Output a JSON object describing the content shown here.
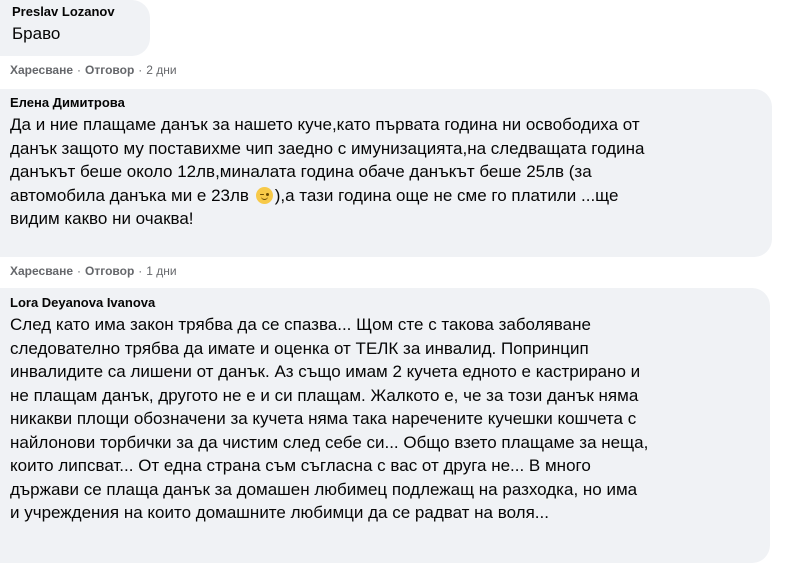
{
  "comments": [
    {
      "author": "Preslav Lozanov",
      "text": "Браво",
      "like_label": "Харесване",
      "reply_label": "Отговор",
      "time": "2 дни"
    },
    {
      "author": "Елена Димитрова",
      "text_before_emoji": "Да и ние плащаме данък за нашето куче,като първата година ни освободиха от\nданък защото му поставихме чип заедно с имунизацията,на следващата година\nданъкът беше около 12лв,миналата година обаче данъкът беше 25лв (за\nавтомобила данъка ми е 23лв ",
      "text_after_emoji": "),а тази година още не сме го платили ...ще\nвидим какво ни очаква!",
      "emoji": "wink-face-emoji",
      "like_label": "Харесване",
      "reply_label": "Отговор",
      "time": "1 дни"
    },
    {
      "author": "Lora Deyanova Ivanova",
      "text": "След като има закон трябва да се спазва... Щом сте с такова заболяване\nследователно трябва да имате и оценка от ТЕЛК за инвалид. Попринцип\nинвалидите са лишени от данък. Аз също имам 2 кучета едното е кастрирано и\nне плащам данък, другото не е и си плащам. Жалкото е, че за този данък няма\nникакви площи обозначени за кучета няма така наречените кучешки кошчета с\nнайлонови торбички за да чистим след себе си... Общо взето плащаме за неща,\nкоито липсват... От една страна съм съгласна с вас от друга не... В много\nдържави се плаща данък за домашен любимец подлежащ на разходка, но има\nи учреждения на които домашните любимци да се радват на воля..."
    }
  ],
  "separator": "·"
}
